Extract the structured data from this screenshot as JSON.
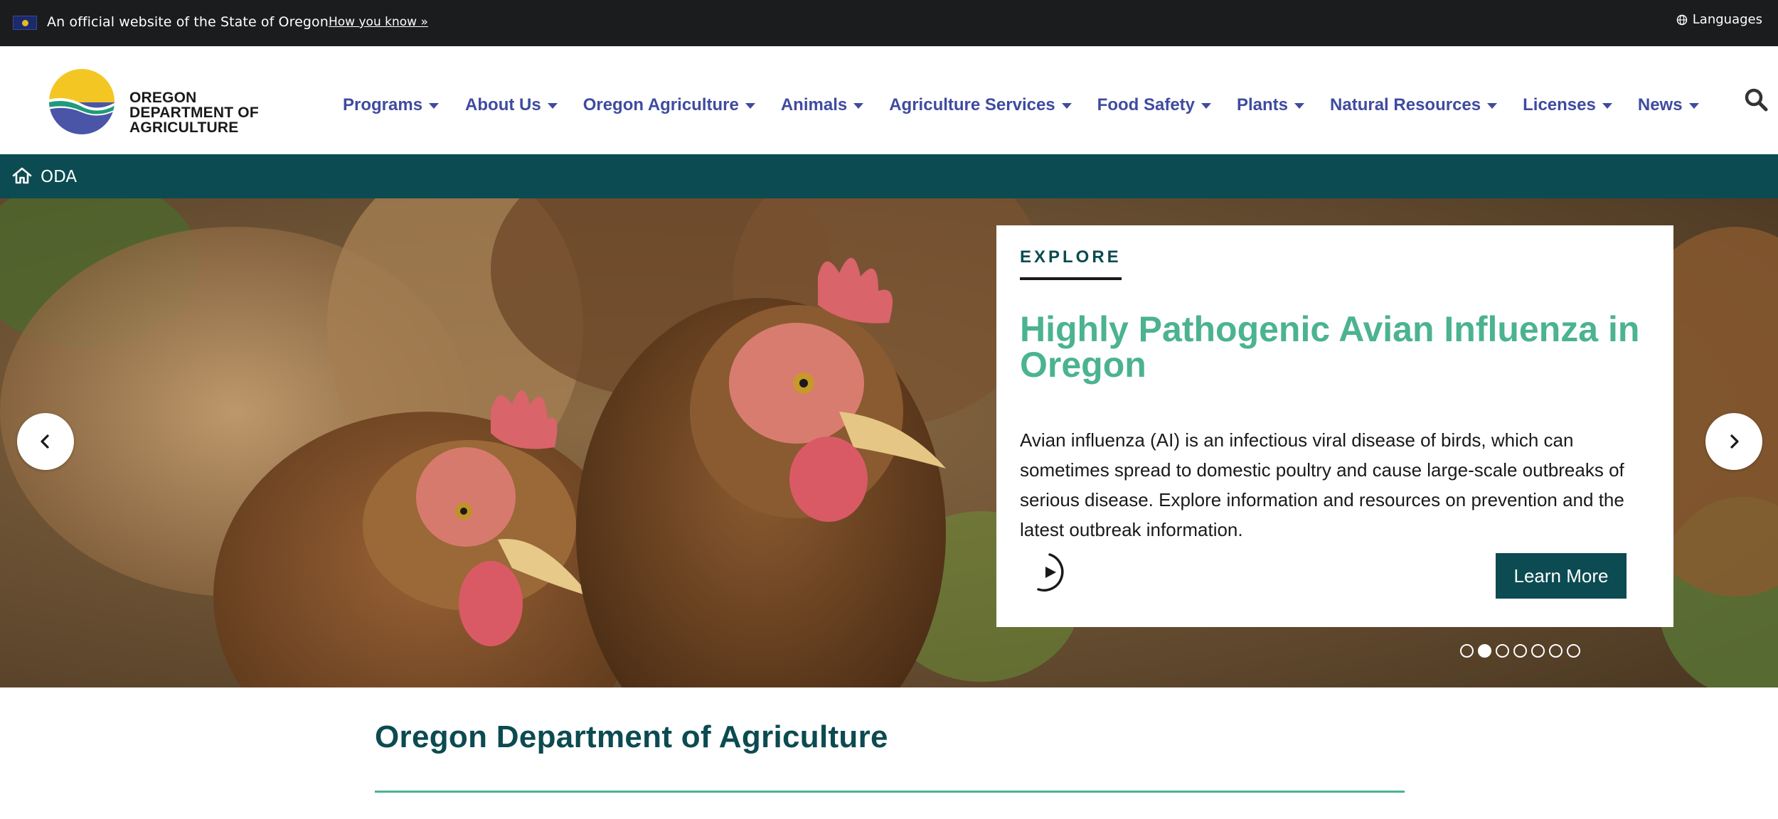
{
  "official_bar": {
    "text": "An official website of the State of Oregon",
    "how_link": "How you know »",
    "languages": "Languages"
  },
  "logo": {
    "line1": "OREGON",
    "line2": "DEPARTMENT OF",
    "line3": "AGRICULTURE"
  },
  "nav": {
    "items": [
      {
        "label": "Programs"
      },
      {
        "label": "About Us"
      },
      {
        "label": "Oregon Agriculture"
      },
      {
        "label": "Animals"
      },
      {
        "label": "Agriculture Services"
      },
      {
        "label": "Food Safety"
      },
      {
        "label": "Plants"
      },
      {
        "label": "Natural Resources"
      },
      {
        "label": "Licenses"
      },
      {
        "label": "News"
      }
    ]
  },
  "breadcrumb": {
    "home_label": "ODA"
  },
  "hero": {
    "kicker": "EXPLORE",
    "title": "Highly Pathogenic Avian Influenza in Oregon",
    "body": "Avian influenza (AI) is an infectious viral disease of birds, which can sometimes spread to domestic poultry and cause large-scale outbreaks of serious disease. Explore information and resources on prevention and the latest outbreak information.",
    "button": "Learn More",
    "slide_count": 7,
    "active_slide": 2
  },
  "page": {
    "title": "Oregon Department of Agriculture"
  },
  "colors": {
    "official_bar": "#1b1c1d",
    "nav_text": "#3f4ba0",
    "brand_teal": "#0b4b51",
    "accent_green": "#4bb38f"
  },
  "icons": {
    "flag": "oregon-flag-icon",
    "languages": "globe-icon",
    "search": "search-icon",
    "home": "home-icon",
    "prev": "chevron-left-icon",
    "next": "chevron-right-icon",
    "play": "play-icon"
  }
}
